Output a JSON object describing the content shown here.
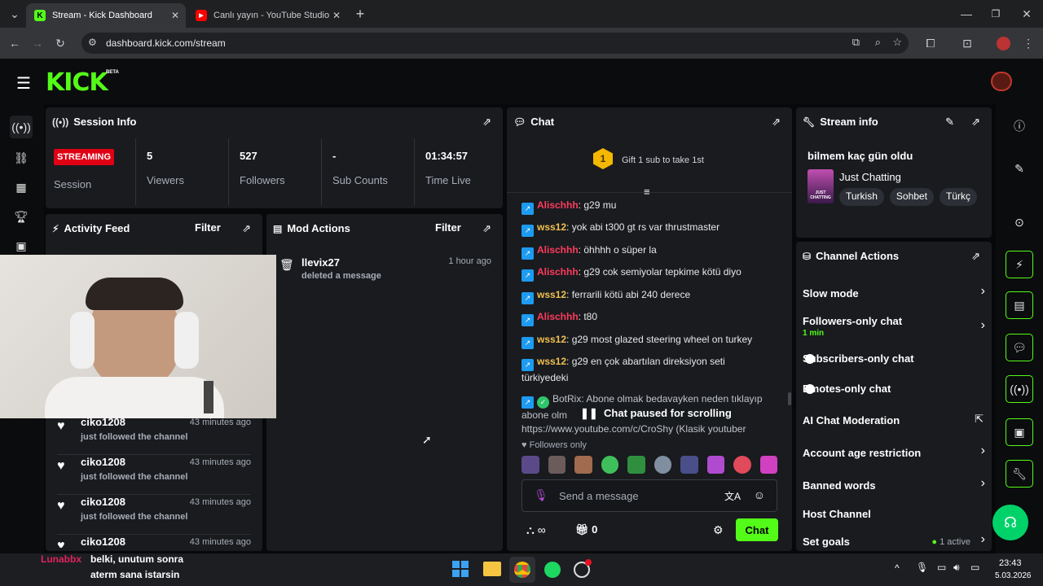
{
  "browser": {
    "tabs": [
      {
        "title": "Stream - Kick Dashboard",
        "favicon": "K"
      },
      {
        "title": "Canlı yayın - YouTube Studio"
      }
    ],
    "url": "dashboard.kick.com/stream"
  },
  "brand": {
    "logo": "KICK",
    "beta": "BETA"
  },
  "session": {
    "title": "Session Info",
    "status_badge": "STREAMING",
    "session_label": "Session",
    "stats": [
      {
        "value": "5",
        "label": "Viewers"
      },
      {
        "value": "527",
        "label": "Followers"
      },
      {
        "value": "-",
        "label": "Sub Counts"
      },
      {
        "value": "01:34:57",
        "label": "Time Live"
      }
    ]
  },
  "activity": {
    "title": "Activity Feed",
    "filter": "Filter",
    "items": [
      {
        "user": "ciko1208",
        "time": "43 minutes ago",
        "action": "just followed the channel"
      },
      {
        "user": "ciko1208",
        "time": "43 minutes ago",
        "action": "just followed the channel"
      },
      {
        "user": "ciko1208",
        "time": "43 minutes ago",
        "action": "just followed the channel"
      },
      {
        "user": "ciko1208",
        "time": "43 minutes ago",
        "action": ""
      }
    ]
  },
  "mod": {
    "title": "Mod Actions",
    "filter": "Filter",
    "items": [
      {
        "user": "llevix27",
        "time": "1 hour ago",
        "action": "deleted a message"
      }
    ]
  },
  "chat": {
    "title": "Chat",
    "gift_count": "1",
    "gift_text": "Gift 1 sub to take 1st",
    "messages": [
      {
        "user": "Alischhh",
        "color": "#ff3b5c",
        "text": ": g29 mu"
      },
      {
        "user": "wss12",
        "color": "#f2c14e",
        "text": ": yok abi t300 gt rs var thrustmaster"
      },
      {
        "user": "Alischhh",
        "color": "#ff3b5c",
        "text": ": öhhhh o süper la"
      },
      {
        "user": "Alischhh",
        "color": "#ff3b5c",
        "text": ": g29 cok semiyolar tepkime kötü diyo"
      },
      {
        "user": "wss12",
        "color": "#f2c14e",
        "text": ": ferrarili kötü abi 240 derece"
      },
      {
        "user": "Alischhh",
        "color": "#ff3b5c",
        "text": ": t80"
      },
      {
        "user": "wss12",
        "color": "#f2c14e",
        "text": ": g29 most glazed steering wheel on turkey"
      },
      {
        "user": "wss12",
        "color": "#f2c14e",
        "text": ": g29 en çok abartılan direksiyon seti türkiyedeki"
      }
    ],
    "bot_line1": "BotRix: Abone olmak bedavayken neden tıklayıp",
    "bot_line2": "abone olm",
    "bot_line3": "https://www.youtube.com/c/CroShy (Klasik youtuber",
    "paused": "Chat paused for scrolling",
    "followers_only": "Followers only",
    "input_placeholder": "Send a message",
    "chat_button": "Chat",
    "infinite": "∞",
    "gift_total": "0"
  },
  "stream_info": {
    "title": "Stream info",
    "stream_title": "bilmem kaç gün oldu",
    "category": "Just Chatting",
    "thumb_text": "JUST CHATTING",
    "tags": [
      "Turkish",
      "Sohbet",
      "Türkç"
    ]
  },
  "channel_actions": {
    "title": "Channel Actions",
    "items": [
      {
        "label": "Slow mode",
        "type": "chevron",
        "sub": ""
      },
      {
        "label": "Followers-only chat",
        "type": "chevron",
        "sub": "1 min"
      },
      {
        "label": "Subscribers-only chat",
        "type": "toggle",
        "sub": ""
      },
      {
        "label": "Emotes-only chat",
        "type": "toggle",
        "sub": ""
      },
      {
        "label": "AI Chat Moderation",
        "type": "external",
        "sub": ""
      },
      {
        "label": "Account age restriction",
        "type": "chevron",
        "sub": ""
      },
      {
        "label": "Banned words",
        "type": "chevron",
        "sub": ""
      },
      {
        "label": "Host Channel",
        "type": "none",
        "sub": ""
      },
      {
        "label": "Set goals",
        "type": "chevron",
        "sub": "",
        "status": "1 active"
      }
    ]
  },
  "overlay_chat": {
    "user": "Lunabbx",
    "line1": "belki, unutum sonra",
    "line2": "aterm sana istarsin"
  },
  "taskbar": {
    "time": "23:43",
    "date": "5.03.2026"
  },
  "colors": {
    "accent": "#53fc18",
    "panel": "#191b1f",
    "bg": "#070809"
  }
}
